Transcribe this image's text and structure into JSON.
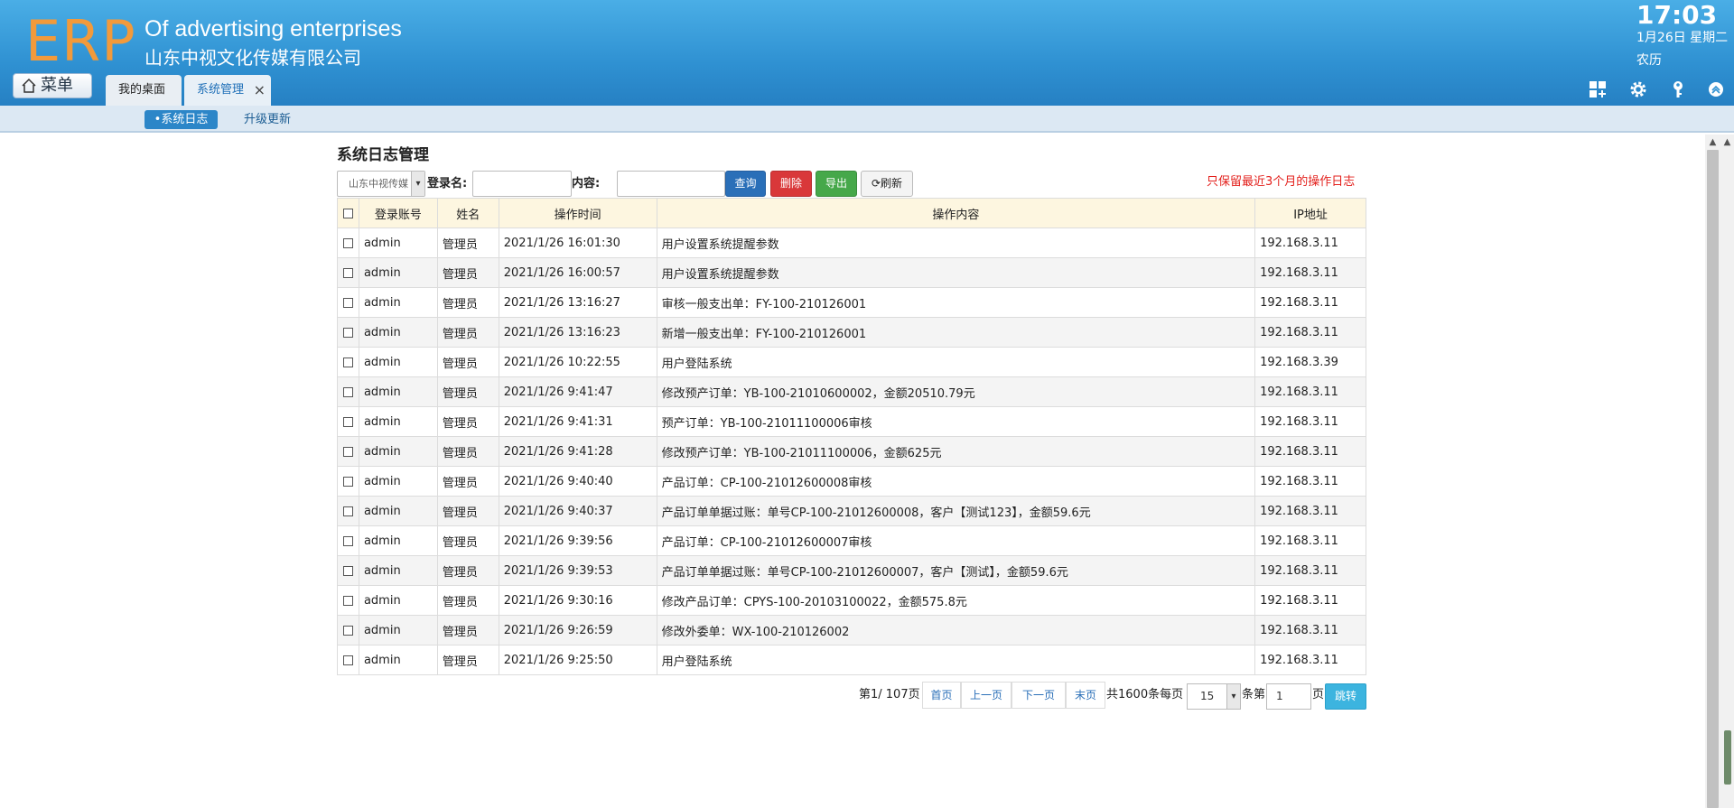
{
  "header": {
    "logo": "ERP",
    "slogan": "Of advertising enterprises",
    "company": "山东中视文化传媒有限公司",
    "clock": "17:03",
    "date": "1月26日 星期二",
    "lunar": "农历",
    "menu_label": "菜单",
    "icons": [
      "dashboard-icon",
      "gear-icon",
      "key-icon",
      "collapse-icon"
    ]
  },
  "tabs": [
    {
      "label": "我的桌面"
    },
    {
      "label": "系统管理",
      "close": "×"
    }
  ],
  "subnav": {
    "active": "•系统日志",
    "items": [
      "升级更新"
    ]
  },
  "page": {
    "title": "系统日志管理",
    "company_select": "山东中视传媒",
    "login_label": "登录名:",
    "content_label": "内容:",
    "btn_query": "查询",
    "btn_delete": "删除",
    "btn_export": "导出",
    "btn_refresh": "刷新",
    "notice": "只保留最近3个月的操作日志"
  },
  "table": {
    "headers": [
      "登录账号",
      "姓名",
      "操作时间",
      "操作内容",
      "IP地址"
    ],
    "rows": [
      [
        "admin",
        "管理员",
        "2021/1/26 16:01:30",
        "用户设置系统提醒参数",
        "192.168.3.11"
      ],
      [
        "admin",
        "管理员",
        "2021/1/26 16:00:57",
        "用户设置系统提醒参数",
        "192.168.3.11"
      ],
      [
        "admin",
        "管理员",
        "2021/1/26 13:16:27",
        "审核一般支出单：FY-100-210126001",
        "192.168.3.11"
      ],
      [
        "admin",
        "管理员",
        "2021/1/26 13:16:23",
        "新增一般支出单：FY-100-210126001",
        "192.168.3.11"
      ],
      [
        "admin",
        "管理员",
        "2021/1/26 10:22:55",
        "用户登陆系统",
        "192.168.3.39"
      ],
      [
        "admin",
        "管理员",
        "2021/1/26 9:41:47",
        "修改预产订单：YB-100-21010600002，金额20510.79元",
        "192.168.3.11"
      ],
      [
        "admin",
        "管理员",
        "2021/1/26 9:41:31",
        "预产订单：YB-100-21011100006审核",
        "192.168.3.11"
      ],
      [
        "admin",
        "管理员",
        "2021/1/26 9:41:28",
        "修改预产订单：YB-100-21011100006，金额625元",
        "192.168.3.11"
      ],
      [
        "admin",
        "管理员",
        "2021/1/26 9:40:40",
        "产品订单：CP-100-21012600008审核",
        "192.168.3.11"
      ],
      [
        "admin",
        "管理员",
        "2021/1/26 9:40:37",
        "产品订单单据过账：单号CP-100-21012600008，客户【测试123】，金额59.6元",
        "192.168.3.11"
      ],
      [
        "admin",
        "管理员",
        "2021/1/26 9:39:56",
        "产品订单：CP-100-21012600007审核",
        "192.168.3.11"
      ],
      [
        "admin",
        "管理员",
        "2021/1/26 9:39:53",
        "产品订单单据过账：单号CP-100-21012600007，客户【测试】，金额59.6元",
        "192.168.3.11"
      ],
      [
        "admin",
        "管理员",
        "2021/1/26 9:30:16",
        "修改产品订单：CPYS-100-20103100022，金额575.8元",
        "192.168.3.11"
      ],
      [
        "admin",
        "管理员",
        "2021/1/26 9:26:59",
        "修改外委单：WX-100-210126002",
        "192.168.3.11"
      ],
      [
        "admin",
        "管理员",
        "2021/1/26 9:25:50",
        "用户登陆系统",
        "192.168.3.11"
      ]
    ]
  },
  "pager": {
    "info": "第1/ 107页",
    "first": "首页",
    "prev": "上一页",
    "next": "下一页",
    "last": "末页",
    "total": "共1600条每页",
    "page_size": "15",
    "mid": "条第",
    "page_input": "1",
    "ye": "页",
    "go": "跳转"
  },
  "colors": {
    "header_blue": "#2f91d2",
    "logo_orange": "#f29a3b",
    "query_blue": "#2a6fb8",
    "delete_red": "#d9383a",
    "export_green": "#46a84a",
    "notice_red": "#e3201c",
    "go_cyan": "#3cb4df"
  }
}
